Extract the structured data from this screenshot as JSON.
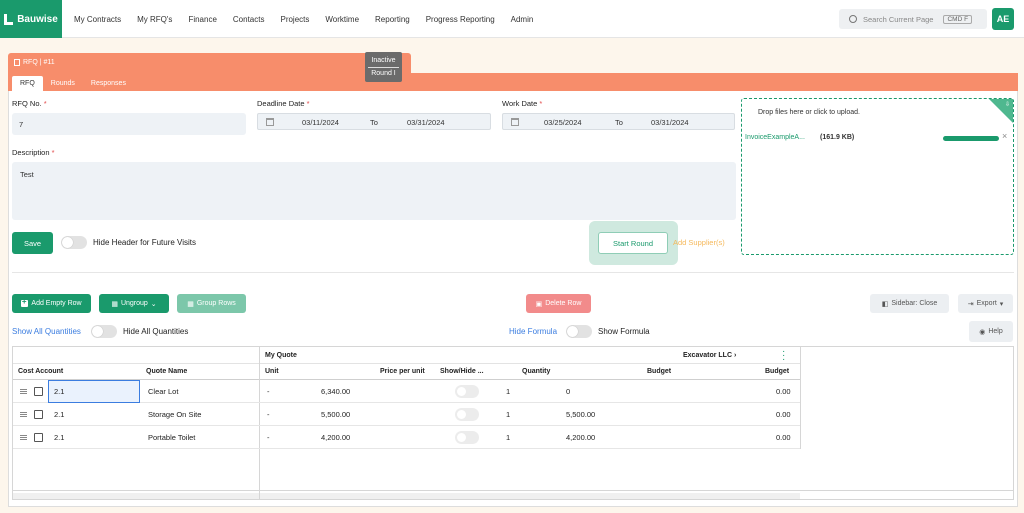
{
  "app": {
    "brand": "Bauwise",
    "avatar": "AE"
  },
  "nav": [
    "My Contracts",
    "My RFQ's",
    "Finance",
    "Contacts",
    "Projects",
    "Worktime",
    "Reporting",
    "Progress Reporting",
    "Admin"
  ],
  "search": {
    "placeholder": "Search Current Page",
    "shortcut": "CMD F"
  },
  "rfq": {
    "title": "RFQ | #11",
    "status": "Inactive",
    "round": "Round I",
    "tabs": [
      "RFQ",
      "Rounds",
      "Responses"
    ]
  },
  "form": {
    "rfq_no_label": "RFQ No.",
    "rfq_no": "7",
    "deadline_label": "Deadline Date",
    "deadline_from": "03/11/2024",
    "deadline_to": "03/31/2024",
    "work_label": "Work Date",
    "work_from": "03/25/2024",
    "work_to": "03/31/2024",
    "to_label": "To",
    "required_mark": "*",
    "description_label": "Description",
    "description": "Test",
    "save": "Save",
    "hide_header": "Hide Header for Future Visits",
    "start_round": "Start Round",
    "add_suppliers": "Add Supplier(s)"
  },
  "upload": {
    "hint": "Drop files here or click to upload.",
    "file_name": "InvoiceExampleA...",
    "file_size": "(161.9 KB)",
    "progress": 1.0,
    "close": "×"
  },
  "toolbar": {
    "add_empty_row": "Add Empty Row",
    "ungroup": "Ungroup",
    "group_rows": "Group Rows",
    "delete_row": "Delete Row",
    "sidebar": "Sidebar: Close",
    "export": "Export",
    "show_all_quantities": "Show All Quantities",
    "hide_all_quantities": "Hide All Quantities",
    "hide_formula": "Hide Formula",
    "show_formula": "Show Formula",
    "help": "Help"
  },
  "grid": {
    "group_headers": {
      "my_quote": "My Quote",
      "supplier": "Excavator LLC"
    },
    "columns": [
      "Cost Account",
      "Quote Name",
      "Unit",
      "Price per unit",
      "Show/Hide ...",
      "Quantity",
      "Budget",
      "Budget"
    ],
    "rows": [
      {
        "cost_account": "2.1",
        "quote_name": "Clear Lot",
        "unit": "-",
        "price": "6,340.00",
        "quantity": "1",
        "budget": "0",
        "supplier_budget": "0.00"
      },
      {
        "cost_account": "2.1",
        "quote_name": "Storage On Site",
        "unit": "-",
        "price": "5,500.00",
        "quantity": "1",
        "budget": "5,500.00",
        "supplier_budget": "0.00"
      },
      {
        "cost_account": "2.1",
        "quote_name": "Portable Toilet",
        "unit": "-",
        "price": "4,200.00",
        "quantity": "1",
        "budget": "4,200.00",
        "supplier_budget": "0.00"
      }
    ]
  },
  "colors": {
    "brand": "#1a9a6c",
    "header": "#f78d6b",
    "link": "#3b7de0",
    "warning": "#f5b95c",
    "danger": "#f28b8b"
  }
}
